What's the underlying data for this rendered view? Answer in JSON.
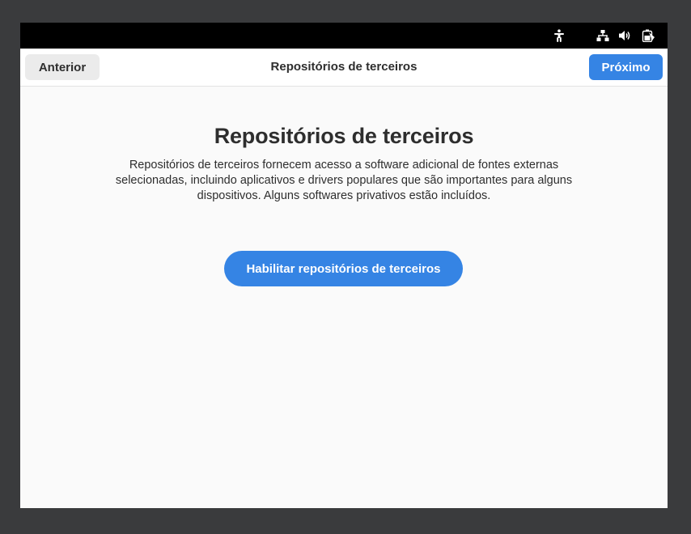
{
  "topbar": {
    "icons": [
      "accessibility-icon",
      "network-wired-icon",
      "volume-icon",
      "battery-icon"
    ]
  },
  "header": {
    "prev_label": "Anterior",
    "title": "Repositórios de terceiros",
    "next_label": "Próximo"
  },
  "main": {
    "title": "Repositórios de terceiros",
    "description": "Repositórios de terceiros fornecem acesso a software adicional de fontes externas selecionadas, incluindo aplicativos e drivers populares que são importantes para alguns dispositivos. Alguns softwares privativos estão incluídos.",
    "enable_label": "Habilitar repositórios de terceiros"
  },
  "colors": {
    "accent": "#3584e4",
    "topbar": "#000000",
    "background": "#fafafa",
    "desktop": "#3a3b3d"
  }
}
